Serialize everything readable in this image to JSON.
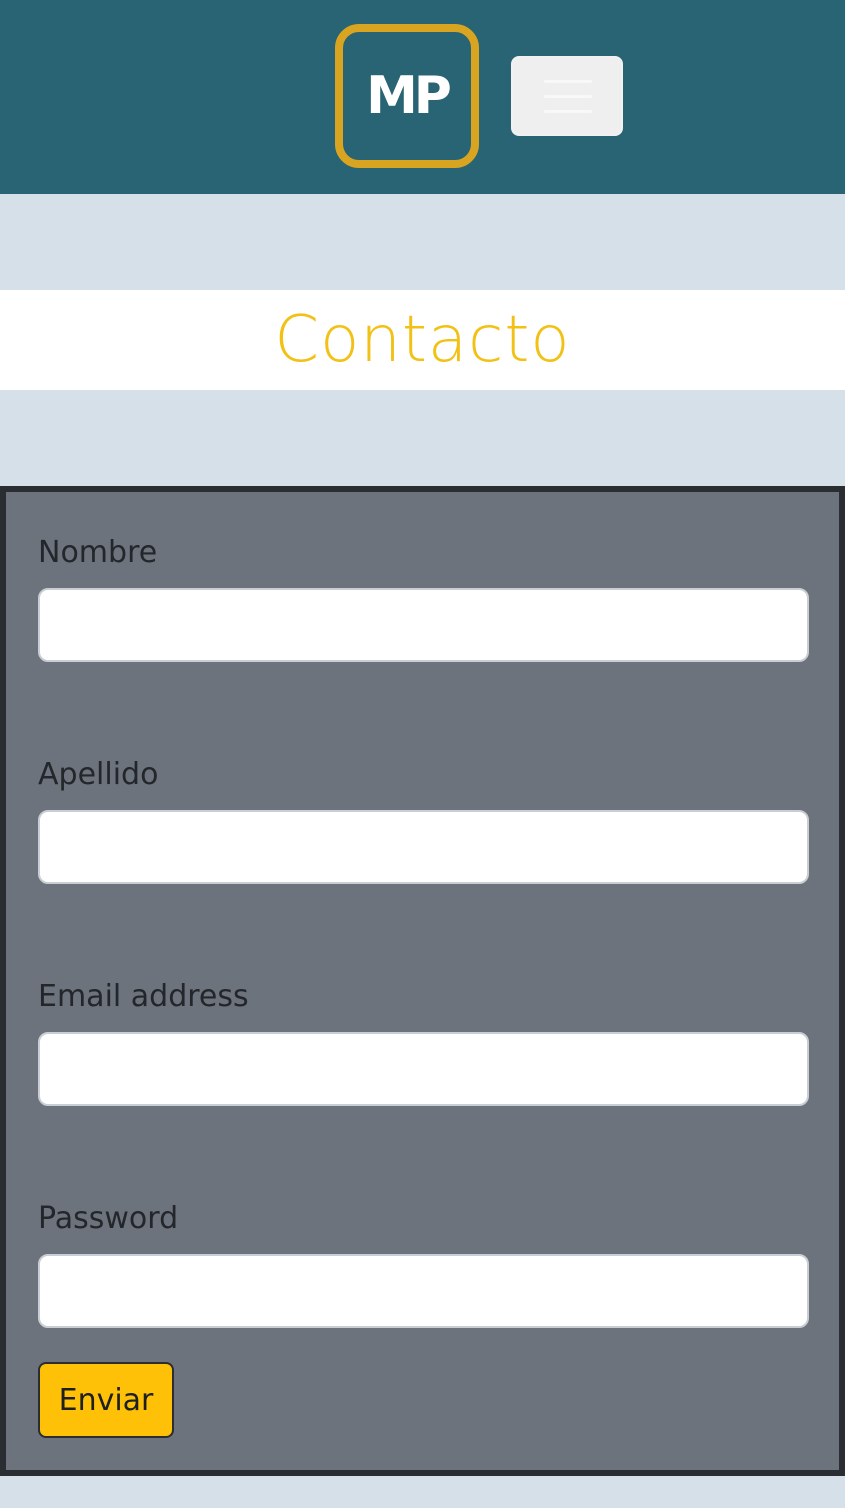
{
  "navbar": {
    "logo_text": "MP",
    "toggler_icon": "hamburger-menu-icon"
  },
  "page": {
    "title": "Contacto"
  },
  "form": {
    "fields": [
      {
        "label": "Nombre",
        "value": "",
        "placeholder": ""
      },
      {
        "label": "Apellido",
        "value": "",
        "placeholder": ""
      },
      {
        "label": "Email address",
        "value": "",
        "placeholder": ""
      },
      {
        "label": "Password",
        "value": "",
        "placeholder": ""
      }
    ],
    "submit_label": "Enviar"
  },
  "colors": {
    "navbar_bg": "#286474",
    "logo_border": "#d9a520",
    "title": "#f2c116",
    "page_bg": "#d5e0e9",
    "form_bg": "#6c737c",
    "button_bg": "#ffc107"
  }
}
